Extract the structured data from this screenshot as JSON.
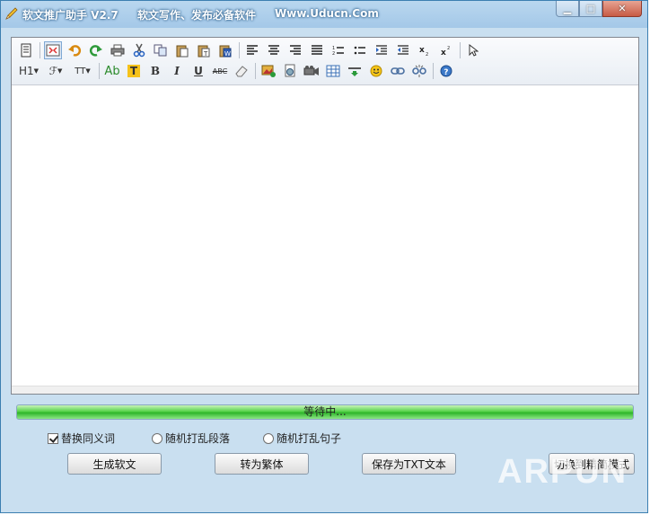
{
  "window": {
    "title": "软文推广助手 V2.7",
    "subtitle": "软文写作、发布必备软件",
    "website": "Www.Uducn.Com",
    "minimize_glyph": "▁",
    "maximize_glyph": "□",
    "close_glyph": "✕"
  },
  "toolbar": {
    "row1": [
      "source-icon",
      "preview-icon",
      "undo-icon",
      "redo-icon",
      "print-icon",
      "cut-icon",
      "copy-icon",
      "paste-icon",
      "paste-text-icon",
      "paste-word-icon",
      "align-left-icon",
      "align-center-icon",
      "align-right-icon",
      "justify-icon",
      "ordered-list-icon",
      "unordered-list-icon",
      "indent-icon",
      "outdent-icon",
      "subscript-icon",
      "superscript-icon",
      "select-icon"
    ],
    "row2": {
      "heading_label": "H1",
      "font_family_label": "ℱ",
      "font_size_label": "TT",
      "font_color_label": "Ab",
      "highlight_label": "T",
      "bold_label": "B",
      "italic_label": "I",
      "underline_label": "U",
      "strike_label": "ABC",
      "icons": [
        "eraser-icon",
        "image-icon",
        "flash-icon",
        "media-icon",
        "table-icon",
        "hr-icon",
        "emoticon-icon",
        "link-icon",
        "unlink-icon",
        "help-icon"
      ]
    }
  },
  "progress": {
    "label": "等待中...",
    "fill_fraction": 1.0
  },
  "options": {
    "replace_synonyms": {
      "label": "替换同义词",
      "checked": true
    },
    "shuffle_paragraphs": {
      "label": "随机打乱段落",
      "checked": false
    },
    "shuffle_sentences": {
      "label": "随机打乱句子",
      "checked": false
    }
  },
  "buttons": {
    "generate": "生成软文",
    "convert_traditional": "转为繁体",
    "save_txt": "保存为TXT文本",
    "switch_mode": "切换到精简模式"
  },
  "watermark": "ARPUN"
}
